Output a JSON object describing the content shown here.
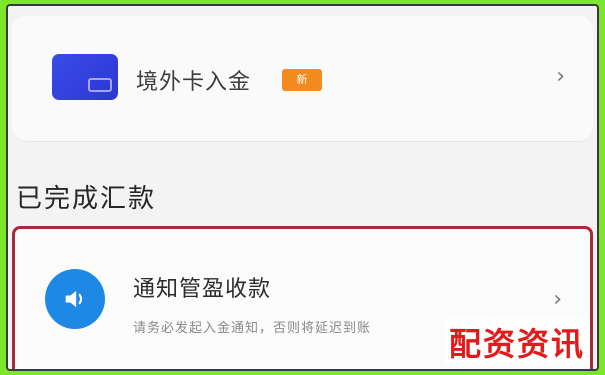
{
  "top_row": {
    "title": "境外卡入金",
    "tag": "新",
    "chevron": "›"
  },
  "section": {
    "title": "已完成汇款"
  },
  "notify_row": {
    "title": "通知管盈收款",
    "subtitle": "请务必发起入金通知，否则将延迟到账",
    "chevron": "›"
  },
  "watermark": "配资资讯",
  "colors": {
    "accent_blue": "#1e88e5",
    "card_blue": "#3a4be6",
    "tag_orange": "#f28a1e",
    "highlight_border": "#a52a3d",
    "watermark_red": "#e11b1b"
  }
}
